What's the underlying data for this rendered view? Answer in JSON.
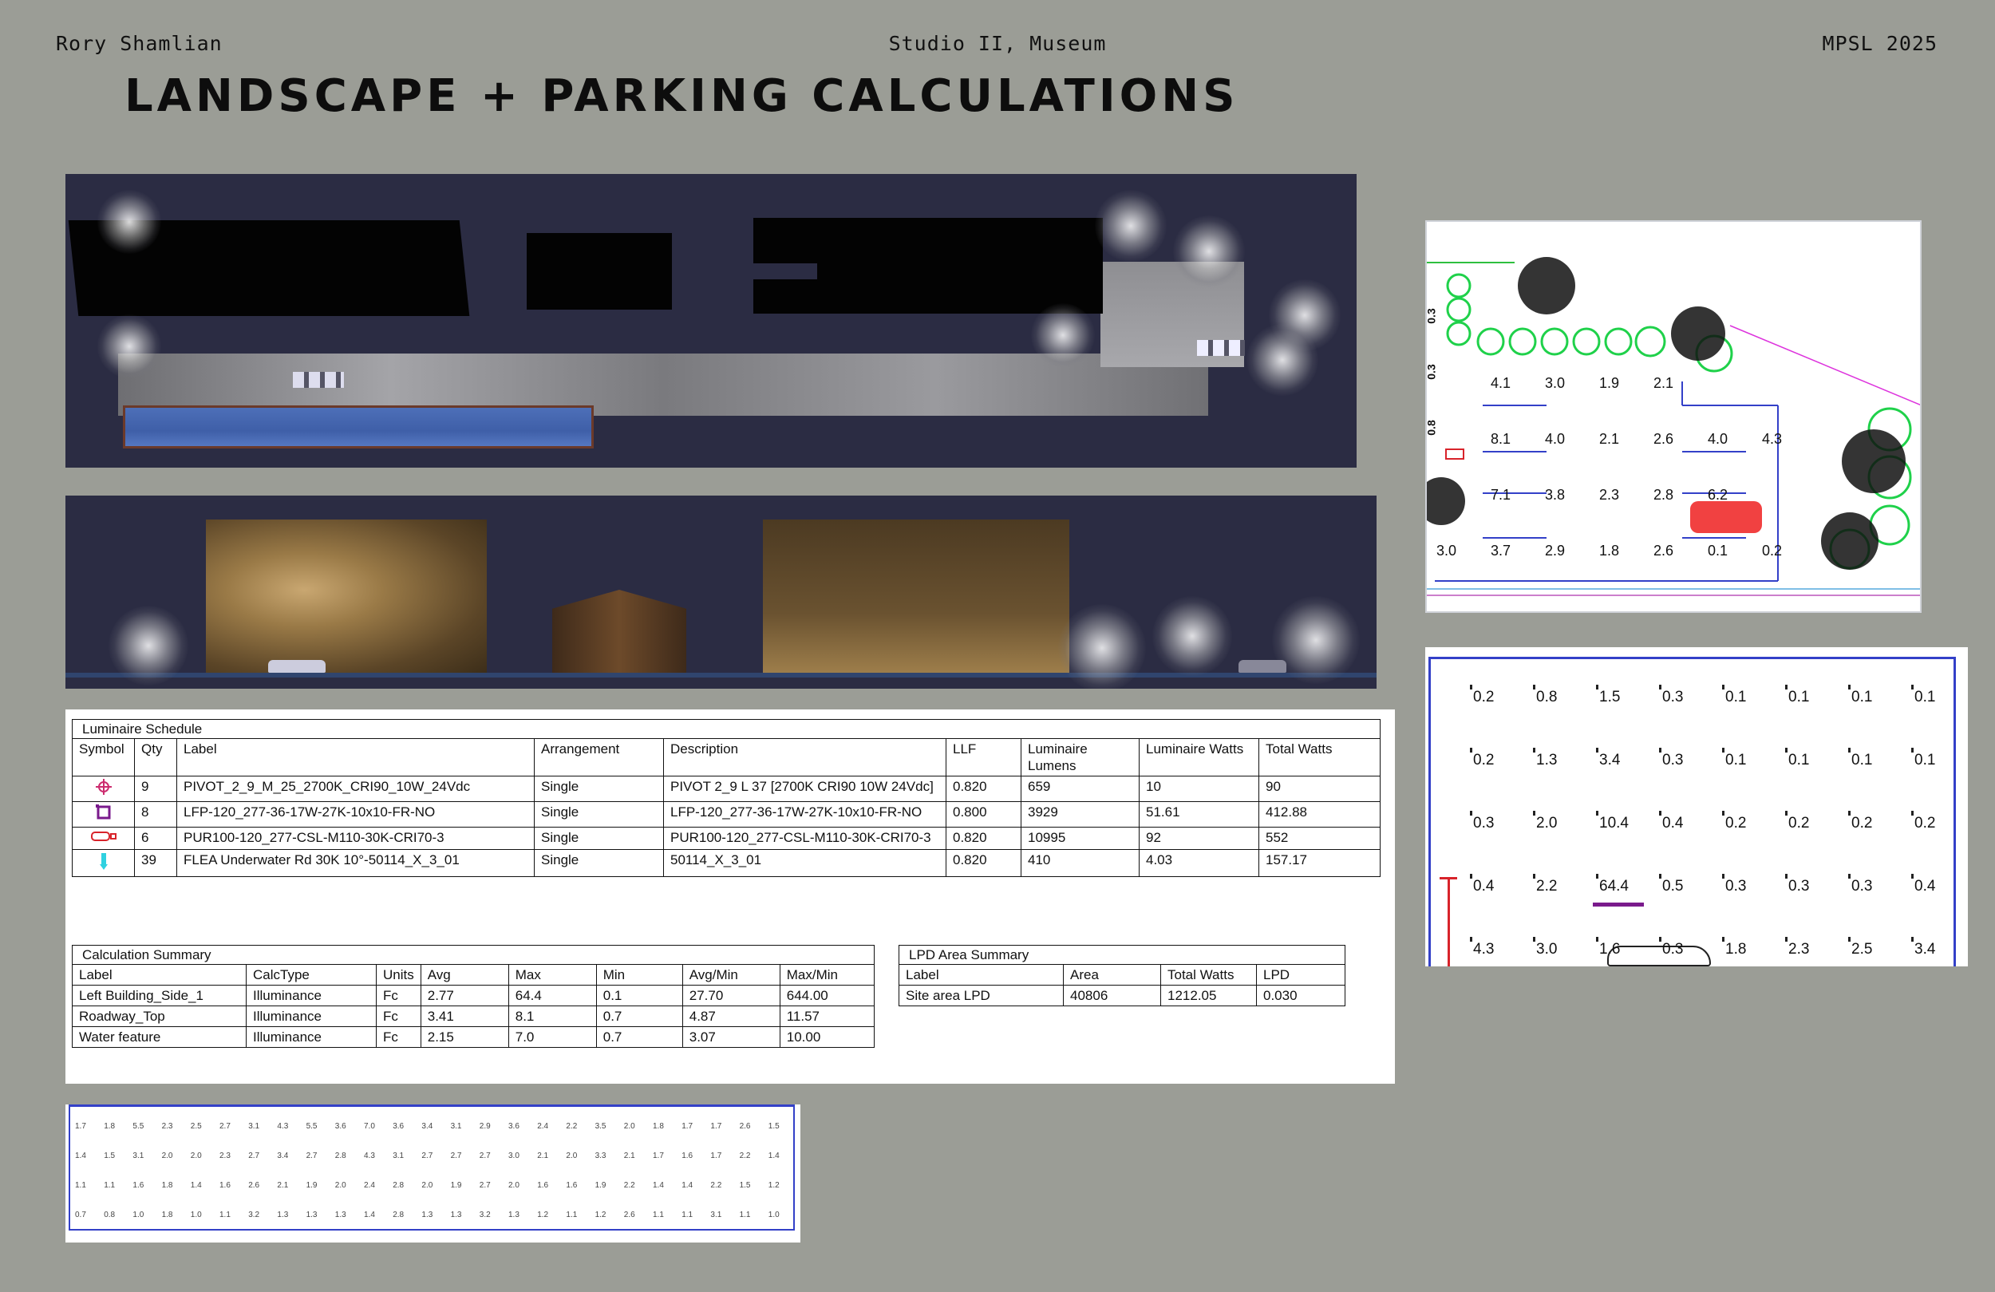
{
  "header": {
    "author": "Rory Shamlian",
    "course": "Studio II, Museum",
    "year": "MPSL 2025",
    "title": "LANDSCAPE + PARKING CALCULATIONS"
  },
  "luminaire_schedule": {
    "caption": "Luminaire Schedule",
    "columns": [
      "Symbol",
      "Qty",
      "Label",
      "Arrangement",
      "Description",
      "LLF",
      "Luminaire Lumens",
      "Luminaire Watts",
      "Total Watts"
    ],
    "rows": [
      {
        "qty": "9",
        "label": "PIVOT_2_9_M_25_2700K_CRI90_10W_24Vdc",
        "arrangement": "Single",
        "description": "PIVOT 2_9 L 37 [2700K CRI90 10W 24Vdc]",
        "llf": "0.820",
        "lumens": "659",
        "watts": "10",
        "total": "90",
        "symbol_color": "#cc2b6e",
        "symbol_icon": "crosshair-icon"
      },
      {
        "qty": "8",
        "label": "LFP-120_277-36-17W-27K-10x10-FR-NO",
        "arrangement": "Single",
        "description": "LFP-120_277-36-17W-27K-10x10-FR-NO",
        "llf": "0.800",
        "lumens": "3929",
        "watts": "51.61",
        "total": "412.88",
        "symbol_color": "#7a1a8c",
        "symbol_icon": "square-fixture-icon"
      },
      {
        "qty": "6",
        "label": "PUR100-120_277-CSL-M110-30K-CRI70-3",
        "arrangement": "Single",
        "description": "PUR100-120_277-CSL-M110-30K-CRI70-3",
        "llf": "0.820",
        "lumens": "10995",
        "watts": "92",
        "total": "552",
        "symbol_color": "#d8232a",
        "symbol_icon": "pole-fixture-icon"
      },
      {
        "qty": "39",
        "label": "FLEA Underwater Rd 30K 10°-50114_X_3_01",
        "arrangement": "Single",
        "description": "50114_X_3_01",
        "llf": "0.820",
        "lumens": "410",
        "watts": "4.03",
        "total": "157.17",
        "symbol_color": "#2fd1e0",
        "symbol_icon": "underwater-fixture-icon"
      }
    ]
  },
  "calculation_summary": {
    "caption": "Calculation Summary",
    "columns": [
      "Label",
      "CalcType",
      "Units",
      "Avg",
      "Max",
      "Min",
      "Avg/Min",
      "Max/Min"
    ],
    "rows": [
      {
        "label": "Left Building_Side_1",
        "type": "Illuminance",
        "units": "Fc",
        "avg": "2.77",
        "max": "64.4",
        "min": "0.1",
        "avgmin": "27.70",
        "maxmin": "644.00"
      },
      {
        "label": "Roadway_Top",
        "type": "Illuminance",
        "units": "Fc",
        "avg": "3.41",
        "max": "8.1",
        "min": "0.7",
        "avgmin": "4.87",
        "maxmin": "11.57"
      },
      {
        "label": "Water feature",
        "type": "Illuminance",
        "units": "Fc",
        "avg": "2.15",
        "max": "7.0",
        "min": "0.7",
        "avgmin": "3.07",
        "maxmin": "10.00"
      }
    ]
  },
  "lpd_summary": {
    "caption": "LPD Area Summary",
    "columns": [
      "Label",
      "Area",
      "Total Watts",
      "LPD"
    ],
    "rows": [
      {
        "label": "Site area LPD",
        "area": "40806",
        "total": "1212.05",
        "lpd": "0.030"
      }
    ]
  },
  "parking_plot": {
    "side_labels": [
      "0.3",
      "0.3",
      "0.8"
    ],
    "points": [
      "4.1",
      "3.0",
      "1.9",
      "2.1",
      "8.1",
      "4.0",
      "2.1",
      "2.6",
      "4.0",
      "4.3",
      "7.1",
      "3.8",
      "2.3",
      "2.8",
      "6.2",
      "3.0",
      "3.7",
      "2.9",
      "1.8",
      "2.6",
      "0.1",
      "0.2"
    ]
  },
  "grid_plot": {
    "rows": [
      [
        "0.2",
        "0.8",
        "1.5",
        "0.3",
        "0.1",
        "0.1",
        "0.1",
        "0.1"
      ],
      [
        "0.2",
        "1.3",
        "3.4",
        "0.3",
        "0.1",
        "0.1",
        "0.1",
        "0.1"
      ],
      [
        "0.3",
        "2.0",
        "10.4",
        "0.4",
        "0.2",
        "0.2",
        "0.2",
        "0.2"
      ],
      [
        "0.4",
        "2.2",
        "64.4",
        "0.5",
        "0.3",
        "0.3",
        "0.3",
        "0.4"
      ],
      [
        "4.3",
        "3.0",
        "1.6",
        "0.3",
        "1.8",
        "2.3",
        "2.5",
        "3.4"
      ]
    ]
  },
  "strip_plot": {
    "rows": [
      [
        "1.7",
        "1.8",
        "5.5",
        "2.3",
        "2.5",
        "2.7",
        "3.1",
        "4.3",
        "5.5",
        "3.6",
        "7.0",
        "3.6",
        "3.4",
        "3.1",
        "2.9",
        "3.6",
        "2.4",
        "2.2",
        "3.5",
        "2.0",
        "1.8",
        "1.7",
        "1.7",
        "2.6",
        "1.5"
      ],
      [
        "1.4",
        "1.5",
        "3.1",
        "2.0",
        "2.0",
        "2.3",
        "2.7",
        "3.4",
        "2.7",
        "2.8",
        "4.3",
        "3.1",
        "2.7",
        "2.7",
        "2.7",
        "3.0",
        "2.1",
        "2.0",
        "3.3",
        "2.1",
        "1.7",
        "1.6",
        "1.7",
        "2.2",
        "1.4"
      ],
      [
        "1.1",
        "1.1",
        "1.6",
        "1.8",
        "1.4",
        "1.6",
        "2.6",
        "2.1",
        "1.9",
        "2.0",
        "2.4",
        "2.8",
        "2.0",
        "1.9",
        "2.7",
        "2.0",
        "1.6",
        "1.6",
        "1.9",
        "2.2",
        "1.4",
        "1.4",
        "2.2",
        "1.5",
        "1.2"
      ],
      [
        "0.7",
        "0.8",
        "1.0",
        "1.8",
        "1.0",
        "1.1",
        "3.2",
        "1.3",
        "1.3",
        "1.3",
        "1.4",
        "2.8",
        "1.3",
        "1.3",
        "3.2",
        "1.3",
        "1.2",
        "1.1",
        "1.2",
        "2.6",
        "1.1",
        "1.1",
        "3.1",
        "1.1",
        "1.0"
      ]
    ]
  },
  "colors": {
    "background": "#9b9d96",
    "render_night": "#2b2c43",
    "pool": "#3f5fa8",
    "parking_line": "#3340c8",
    "tree_green": "#1fd14a"
  }
}
